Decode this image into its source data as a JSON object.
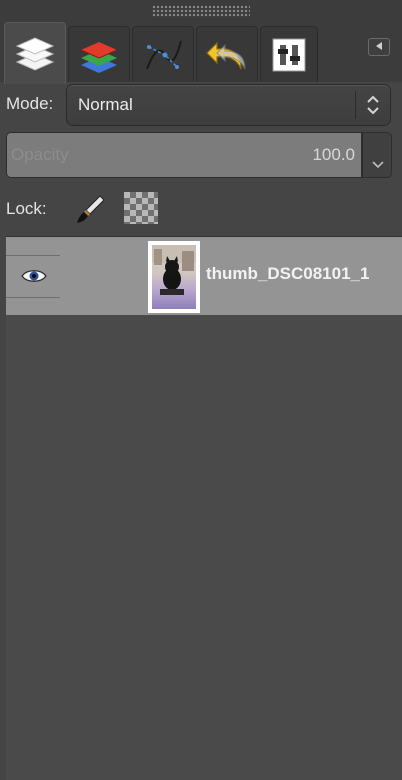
{
  "tabs": [
    {
      "name": "layers",
      "icon": "layers-icon",
      "active": true
    },
    {
      "name": "channels",
      "icon": "channels-icon",
      "active": false
    },
    {
      "name": "paths",
      "icon": "paths-icon",
      "active": false
    },
    {
      "name": "undo-history",
      "icon": "undo-icon",
      "active": false
    },
    {
      "name": "tool-options",
      "icon": "tool-options-icon",
      "active": false
    }
  ],
  "mode": {
    "label": "Mode:",
    "value": "Normal"
  },
  "opacity": {
    "label": "Opacity",
    "value": "100.0"
  },
  "lock": {
    "label": "Lock:"
  },
  "layers": [
    {
      "name": "thumb_DSC08101_1",
      "visible": true,
      "selected": true
    }
  ],
  "colors": {
    "panel_bg": "#454545",
    "selected_row": "#949494",
    "text": "#e6e6e6"
  }
}
